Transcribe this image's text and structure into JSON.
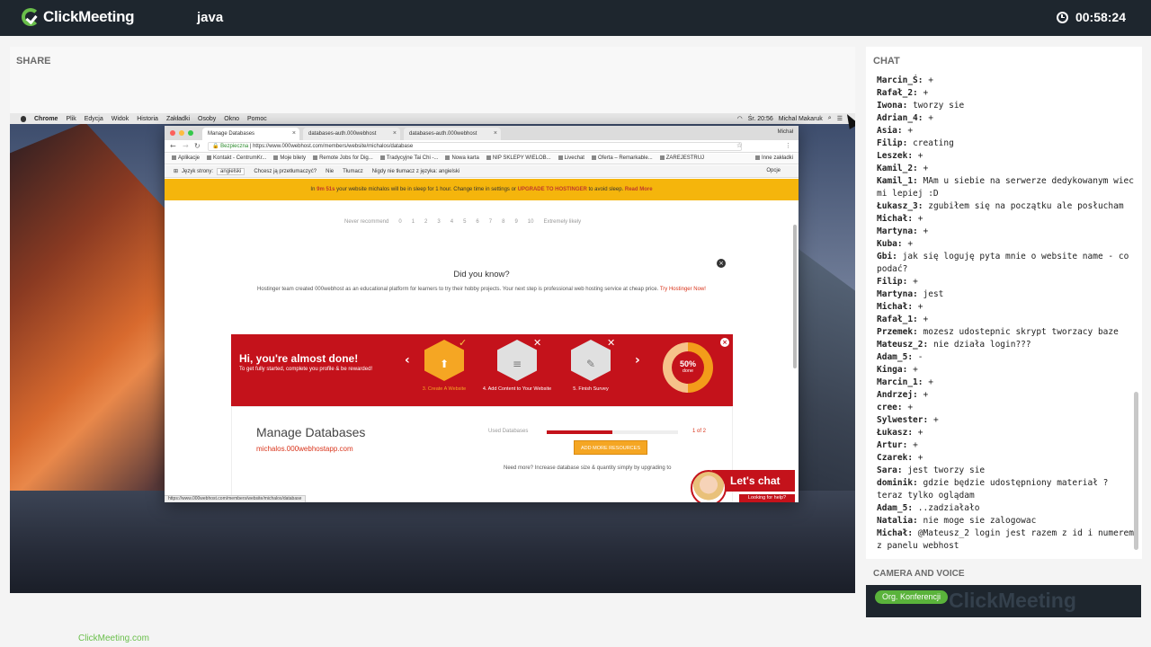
{
  "app": {
    "brand": "ClickMeeting",
    "room_name": "java",
    "timer": "00:58:24",
    "footer_link": "ClickMeeting.com"
  },
  "share": {
    "title": "SHARE",
    "mac_menu": [
      "Chrome",
      "Plik",
      "Edycja",
      "Widok",
      "Historia",
      "Zakładki",
      "Osoby",
      "Okno",
      "Pomoc"
    ],
    "mac_status": {
      "time": "Śr. 20:56",
      "user": "Michal Makaruk"
    },
    "browser": {
      "tabs": [
        {
          "label": "Manage Databases",
          "active": true
        },
        {
          "label": "databases-auth.000webhost",
          "active": false
        },
        {
          "label": "databases-auth.000webhost",
          "active": false
        }
      ],
      "user": "Michał",
      "address_secure": "Bezpieczna",
      "address_url": "https://www.000webhost.com/members/website/michalos/database",
      "bookmarks": [
        "Aplikacje",
        "Kontakt - CentrumKr...",
        "Moje bilety",
        "Remote Jobs for Dig...",
        "Tradycyjne Tai Chi -...",
        "Nowa karta",
        "NIP SKLEPY WIELOB...",
        "Livechat",
        "Oferta – Remarkable...",
        "ZAREJESTRUJ",
        "Inne zakładki"
      ],
      "translate": {
        "page_language_label": "Język strony:",
        "page_language": "angielski",
        "question": "Chcesz ją przetłumaczyć?",
        "no": "Nie",
        "translate": "Tłumacz",
        "never": "Nigdy nie tłumacz z języka: angielski",
        "options": "Opcje"
      },
      "sleep_banner": {
        "pre": "In",
        "time": "9m 51s",
        "mid": "your website",
        "site": "michalos",
        "mid2": "will be in sleep for 1 hour. Change time in settings or",
        "cta": "UPGRADE TO HOSTINGER",
        "post": "to avoid sleep.",
        "read_more": "Read More"
      },
      "rating": {
        "left": "Never recommend",
        "values": [
          "0",
          "1",
          "2",
          "3",
          "4",
          "5",
          "6",
          "7",
          "8",
          "9",
          "10"
        ],
        "right": "Extremely likely"
      },
      "did_you_know": {
        "title": "Did you know?",
        "text": "Hostinger team created 000webhost as an educational platform for learners to try their hobby projects. Your next step is professional web hosting service at cheap price.",
        "cta": "Try Hostinger Now!"
      },
      "onboarding": {
        "title": "Hi, you're almost done!",
        "subtitle": "To get fully started, complete you profile & be rewarded!",
        "steps": [
          {
            "label": "3. Create A Website",
            "icon": "upload-icon",
            "status": "done"
          },
          {
            "label": "4. Add Content to Your Website",
            "icon": "content-icon",
            "status": "pending"
          },
          {
            "label": "5. Finish Survey",
            "icon": "pencil-icon",
            "status": "pending"
          }
        ],
        "progress_percent": 50,
        "progress_text": "50%",
        "progress_label": "done"
      },
      "databases": {
        "title": "Manage Databases",
        "url": "michalos.000webhostapp.com",
        "used_label": "Used Databases",
        "used_fraction": 0.5,
        "used_count": "1 of 2",
        "add_button": "ADD MORE RESOURCES",
        "need_more": "Need more? Increase database size & quantity simply by upgrading to"
      },
      "status_url": "https://www.000webhost.com/members/website/michalos/database",
      "lets_chat": {
        "title": "Let's chat",
        "subtitle": "Looking for help?"
      }
    }
  },
  "chat": {
    "title": "CHAT",
    "messages": [
      {
        "author": "Marcin_Ś:",
        "text": "+"
      },
      {
        "author": "Rafał_2:",
        "text": "+"
      },
      {
        "author": "Iwona:",
        "text": "tworzy sie"
      },
      {
        "author": "Adrian_4:",
        "text": "+"
      },
      {
        "author": "Asia:",
        "text": "+"
      },
      {
        "author": "Filip:",
        "text": "creating"
      },
      {
        "author": "Leszek:",
        "text": "+"
      },
      {
        "author": "Kamil_2:",
        "text": "+"
      },
      {
        "author": "Kamil_1:",
        "text": "MAm u siebie na serwerze dedykowanym wiec mi lepiej :D"
      },
      {
        "author": "Łukasz_3:",
        "text": "zgubiłem się na początku ale posłucham"
      },
      {
        "author": "Michał:",
        "text": "+"
      },
      {
        "author": "Martyna:",
        "text": "+"
      },
      {
        "author": "Kuba:",
        "text": "+"
      },
      {
        "author": "Gbi:",
        "text": "jak się loguję pyta mnie o website name - co podać?"
      },
      {
        "author": "Filip:",
        "text": "+"
      },
      {
        "author": "Martyna:",
        "text": "jest"
      },
      {
        "author": "Michał:",
        "text": "+"
      },
      {
        "author": "Rafał_1:",
        "text": "+"
      },
      {
        "author": "Przemek:",
        "text": "mozesz udostepnic skrypt tworzacy baze"
      },
      {
        "author": "Mateusz_2:",
        "text": "nie działa login???"
      },
      {
        "author": "Adam_5:",
        "text": "-"
      },
      {
        "author": "Kinga:",
        "text": "+"
      },
      {
        "author": "Marcin_1:",
        "text": "+"
      },
      {
        "author": "Andrzej:",
        "text": "+"
      },
      {
        "author": "cree:",
        "text": "+"
      },
      {
        "author": "Sylwester:",
        "text": "+"
      },
      {
        "author": "Łukasz:",
        "text": "+"
      },
      {
        "author": "Artur:",
        "text": "+"
      },
      {
        "author": "Czarek:",
        "text": "+"
      },
      {
        "author": "Sara:",
        "text": "jest tworzy sie"
      },
      {
        "author": "dominik:",
        "text": "gdzie będzie udostępniony materiał ? teraz tylko oglądam"
      },
      {
        "author": "Adam_5:",
        "text": "..zadziałało"
      },
      {
        "author": "Natalia:",
        "text": "nie moge sie zalogowac"
      },
      {
        "author": "Michał:",
        "text": "@Mateusz_2 login jest razem z id i numerem z panelu webhost"
      }
    ]
  },
  "camera": {
    "title": "CAMERA AND VOICE",
    "badge": "Org. Konferencji",
    "watermark": "ClickMeeting"
  }
}
